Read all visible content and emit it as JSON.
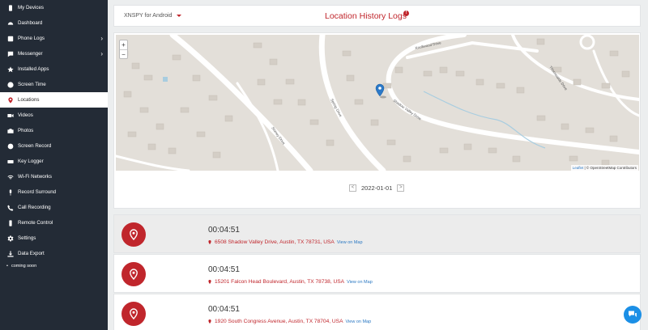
{
  "sidebar": {
    "items": [
      {
        "label": "My Devices",
        "icon": "phone-icon"
      },
      {
        "label": "Dashboard",
        "icon": "dashboard-icon"
      },
      {
        "label": "Phone Logs",
        "icon": "phone-logs-icon",
        "expandable": true
      },
      {
        "label": "Messenger",
        "icon": "messenger-icon",
        "expandable": true
      },
      {
        "label": "Installed Apps",
        "icon": "apps-icon"
      },
      {
        "label": "Screen Time",
        "icon": "clock-icon"
      },
      {
        "label": "Locations",
        "icon": "location-pin-icon",
        "active": true
      },
      {
        "label": "Videos",
        "icon": "video-icon"
      },
      {
        "label": "Photos",
        "icon": "camera-icon"
      },
      {
        "label": "Screen Record",
        "icon": "record-icon"
      },
      {
        "label": "Key Logger",
        "icon": "keyboard-icon"
      },
      {
        "label": "Wi-Fi Networks",
        "icon": "wifi-icon"
      },
      {
        "label": "Record Surround",
        "icon": "microphone-icon"
      },
      {
        "label": "Call Recording",
        "icon": "phone-icon"
      },
      {
        "label": "Remote Control",
        "icon": "remote-icon"
      },
      {
        "label": "Settings",
        "icon": "gear-icon"
      },
      {
        "label": "Data Export",
        "icon": "download-icon"
      }
    ],
    "footer_note": "coming soon"
  },
  "header": {
    "device": "XNSPY for Android",
    "title": "Location History Logs",
    "info_icon": "info-icon"
  },
  "map": {
    "zoom_in": "+",
    "zoom_out": "−",
    "attribution_leaflet": "Leaflet",
    "attribution_rest": "| © OpenStreetMap Contributors",
    "street_labels": [
      "Knollwood Drive",
      "Thornwalde Drive",
      "Shadow Valley Drive",
      "Spring Drive",
      "Stoney Drive"
    ]
  },
  "date_nav": {
    "prev": "<",
    "date": "2022-01-01",
    "next": ">"
  },
  "entries": [
    {
      "time": "00:04:51",
      "address": "6508 Shadow Valley Drive, Austin, TX 78731, USA",
      "link": "View on Map"
    },
    {
      "time": "00:04:51",
      "address": "15201 Falcon Head Boulevard, Austin, TX 78738, USA",
      "link": "View on Map"
    },
    {
      "time": "00:04:51",
      "address": "1920 South Congress Avenue, Austin, TX 78704, USA",
      "link": "View on Map"
    }
  ],
  "colors": {
    "accent": "#c0262c",
    "sidebar": "#232b36",
    "link": "#2a78c2",
    "chat": "#1b8fe6"
  }
}
